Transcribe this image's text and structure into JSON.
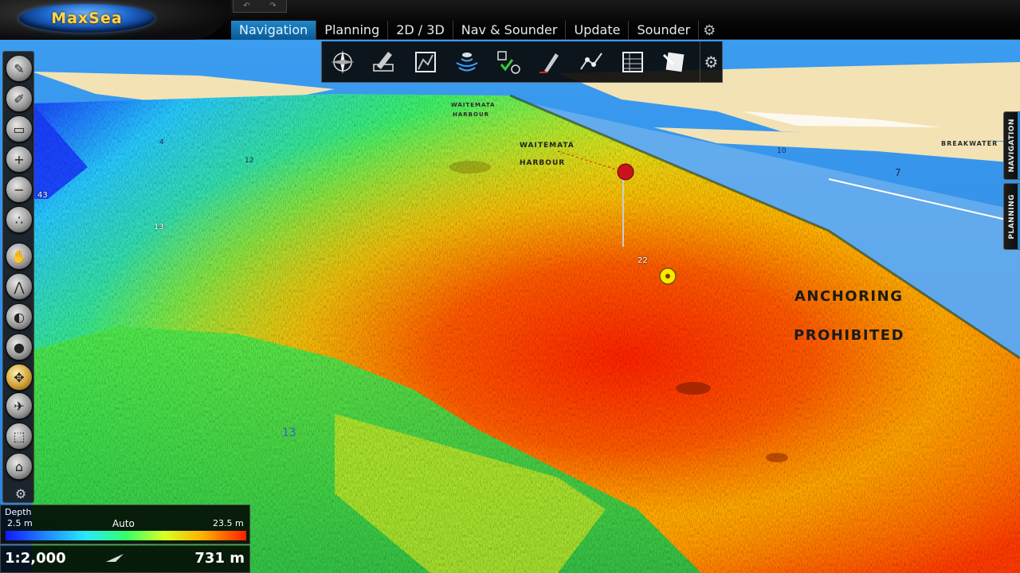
{
  "app": {
    "logo_text": "MaxSea"
  },
  "undo_redo": {
    "undo_icon": "undo-icon",
    "redo_icon": "redo-icon"
  },
  "tabs": [
    {
      "label": "Navigation",
      "active": true
    },
    {
      "label": "Planning",
      "active": false
    },
    {
      "label": "2D / 3D",
      "active": false
    },
    {
      "label": "Nav & Sounder",
      "active": false
    },
    {
      "label": "Update",
      "active": false
    },
    {
      "label": "Sounder",
      "active": false
    }
  ],
  "ribbon": {
    "buttons": [
      "compass-rose-icon",
      "pencil-edit-icon",
      "chart-frame-icon",
      "sonar-waves-icon",
      "route-check-icon",
      "marker-pen-icon",
      "boat-tracks-icon",
      "data-grid-icon",
      "note-icon"
    ]
  },
  "left_tools": [
    "pencil-tool-icon",
    "brush-tool-icon",
    "eraser-tool-icon",
    "zoom-in-icon",
    "zoom-out-icon",
    "points-tool-icon",
    "hand-pan-icon",
    "divider-measure-icon",
    "bucket-tool-icon",
    "drop-tool-icon",
    "move-tool-icon",
    "satellite-icon",
    "select-area-icon",
    "home-view-icon"
  ],
  "side_tabs": {
    "navigation": "NAVIGATION",
    "planning": "PLANNING"
  },
  "chart_labels": {
    "harbour_name_line1": "WAITEMATA",
    "harbour_name_line2": "HARBOUR",
    "harbour_small_1": "WAITEMATA",
    "harbour_small_2": "HARBOUR",
    "anchoring_line1": "ANCHORING",
    "anchoring_line2": "PROHIBITED",
    "breakwater": "BREAKWATER",
    "soundings": {
      "s13a": "13",
      "s13b": "13",
      "s22": "22",
      "s4": "4",
      "s43": "43",
      "s12": "12",
      "s10": "10",
      "s7": "7"
    }
  },
  "depth_legend": {
    "title": "Depth",
    "min": "2.5 m",
    "mode": "Auto",
    "max": "23.5 m"
  },
  "scale": {
    "ratio": "1:2,000",
    "distance": "731 m"
  },
  "colors": {
    "tab_active": "#1f86c9",
    "water": "#2f8fe8",
    "land": "#f3e2b4",
    "deep": "#ff2a00",
    "shallow": "#1418ff"
  }
}
